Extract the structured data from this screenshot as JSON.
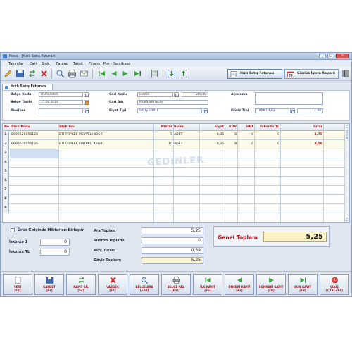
{
  "window": {
    "title": "Nova - [Hızlı Satış Faturası]",
    "controls": [
      "_",
      "□",
      "x"
    ]
  },
  "menu": [
    "Tanımlar",
    "Cari",
    "Stok",
    "Fatura",
    "Taksit",
    "Finans",
    "Pos - Yazarkasa"
  ],
  "toolbar": {
    "tab_active": "Hızlı Satış Faturası",
    "tab_report": "Günlük İşlem Raporu"
  },
  "doc_tab": "Hızlı Satış Faturası",
  "form": {
    "belge_kodu_label": "Belge Kodu",
    "belge_kodu": "HSF000006",
    "belge_tarihi_label": "Belge Tarihi",
    "belge_tarihi": "15.02.2013",
    "plasiyer_label": "Plesiyer",
    "plasiyer": "",
    "cari_kodu_label": "Cari Kodu",
    "cari_kodu": "C0004",
    "cari_bakiye": "200,00",
    "cari_adi_label": "Cari Adı",
    "cari_adi": "PEŞİN SATIŞLAR",
    "fiyat_tipi_label": "Fiyat Tipi",
    "fiyat_tipi": "SATIŞ FİYATI",
    "aciklama_label": "Açıklama",
    "aciklama": "",
    "doviz_tipi_label": "Döviz Tipi",
    "doviz_tipi": "TÜRK LİRASI",
    "doviz_kuru": "1,00"
  },
  "grid": {
    "headers": {
      "no": "No",
      "stok_kodu": "Stok Kodu",
      "stok_adi": "Stok Adı",
      "miktar": "Miktar",
      "birim": "Birim",
      "fiyat": "Fiyat",
      "kdv": "KDV",
      "iskonto1": "İsk1",
      "iskonto_tl": "İskonto TL",
      "tutar": "Tutar"
    },
    "rows": [
      {
        "no": "1",
        "stok_kodu": "8690526056128",
        "stok_adi": "ETİ TOPKEK MEYVELİ 40GR",
        "miktar": "5",
        "birim": "ADET",
        "fiyat": "0,35",
        "kdv": "8",
        "iskonto1": "0",
        "iskonto_tl": "0",
        "tutar": "1,75"
      },
      {
        "no": "2",
        "stok_kodu": "8690526056135",
        "stok_adi": "ETİ TOPKEK FINDIKLI 40GR",
        "miktar": "10",
        "birim": "ADET",
        "fiyat": "0,35",
        "kdv": "8",
        "iskonto1": "0",
        "iskonto_tl": "0",
        "tutar": "3,50"
      },
      {
        "no": "3"
      },
      {
        "no": "4"
      },
      {
        "no": "5"
      },
      {
        "no": "6"
      },
      {
        "no": "7"
      },
      {
        "no": "8"
      },
      {
        "no": "9"
      }
    ],
    "watermark": "GEDİNLER"
  },
  "totals": {
    "urun_girisi_label": "Ürün Girişinde Miktarları Birleştir",
    "iskonto1_label": "İskonto 1",
    "iskonto1": "0",
    "iskonto_tl_label": "İskonto TL",
    "iskonto_tl": "0",
    "ara_toplam_label": "Ara Toplam",
    "ara_toplam": "5,25",
    "indirim_label": "İndirim Toplamı",
    "indirim": "0",
    "kdv_label": "KDV Tutarı",
    "kdv": "0,39",
    "doviz_toplam_label": "Döviz Toplamı",
    "doviz_toplam": "5,25",
    "genel_toplam_label": "Genel Toplam",
    "genel_toplam": "5,25"
  },
  "buttons": [
    {
      "label": "YENİ",
      "key": "[F2]",
      "icon": "new-icon"
    },
    {
      "label": "KAYDET",
      "key": "[F3]",
      "icon": "save-icon"
    },
    {
      "label": "KAYIT SİL",
      "key": "[F4]",
      "icon": "delete-record-icon"
    },
    {
      "label": "VAZGEÇ",
      "key": "[F5]",
      "icon": "cancel-icon"
    },
    {
      "label": "BELGE ARA",
      "key": "[F10]",
      "icon": "search-icon"
    },
    {
      "label": "BELGE YAZ",
      "key": "[F11]",
      "icon": "print-icon"
    },
    {
      "label": "İLK KAYIT",
      "key": "[F6]",
      "icon": "first-record-icon"
    },
    {
      "label": "ÖNCEKİ KAYIT",
      "key": "[F7]",
      "icon": "previous-record-icon"
    },
    {
      "label": "SONRAKİ KAYIT",
      "key": "[F8]",
      "icon": "next-record-icon"
    },
    {
      "label": "SON KAYIT",
      "key": "[F9]",
      "icon": "last-record-icon"
    },
    {
      "label": "ÇIKIŞ",
      "key": "[CTRL+F4]",
      "icon": "exit-icon"
    }
  ]
}
